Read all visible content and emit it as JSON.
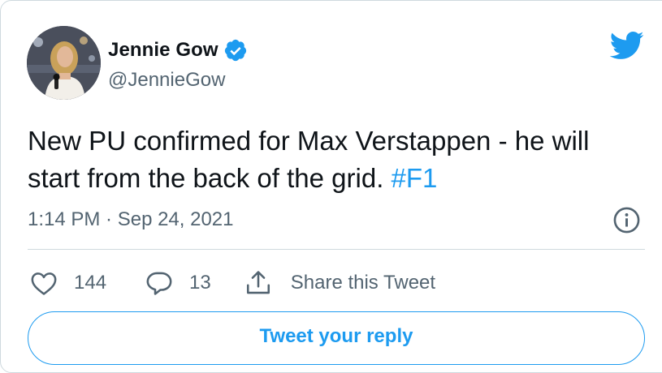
{
  "author": {
    "display_name": "Jennie Gow",
    "handle": "@JennieGow",
    "verified": true,
    "avatar_icon": "profile-photo"
  },
  "tweet": {
    "text": "New PU confirmed for Max Verstappen - he will start from the back of the grid.",
    "hashtag": "#F1",
    "timestamp": "1:14 PM · Sep 24, 2021"
  },
  "actions": {
    "like_count": "144",
    "reply_count": "13",
    "share_label": "Share this Tweet"
  },
  "reply_button_label": "Tweet your reply",
  "icons": {
    "brand": "twitter-bird-icon",
    "info": "info-icon",
    "like": "heart-icon",
    "reply": "speech-bubble-icon",
    "share": "share-icon",
    "verified": "verified-badge-icon"
  },
  "colors": {
    "accent": "#1d9bf0",
    "text": "#0f1419",
    "muted": "#536471",
    "border": "#cfd9de"
  }
}
